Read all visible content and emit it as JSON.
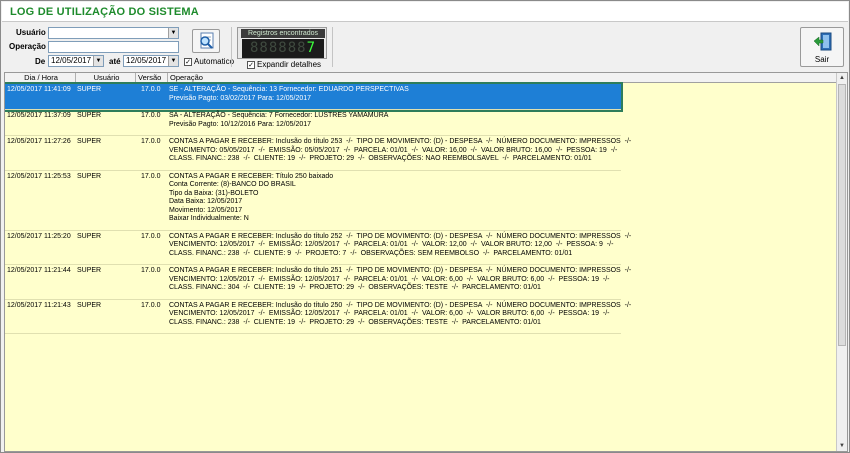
{
  "window": {
    "title": "LOG DE UTILIZAÇÃO DO SISTEMA"
  },
  "filters": {
    "usuario_label": "Usuário",
    "usuario_value": "",
    "operacao_label": "Operação",
    "operacao_value": "",
    "de_label": "De",
    "de_value": "12/05/2017",
    "ate_label": "até",
    "ate_value": "12/05/2017",
    "automatico_label": "Automatico",
    "automatico_checked": true,
    "expandir_label": "Expandir detalhes",
    "expandir_checked": true
  },
  "counter": {
    "caption": "Registros encontrados",
    "digits_dim": "888888",
    "digits_lit": "7"
  },
  "toolbar": {
    "search_icon": "magnifier-document-icon",
    "exit_label": "Sair",
    "exit_icon": "door-exit-icon"
  },
  "grid": {
    "headers": [
      "Dia / Hora",
      "Usuário",
      "Versão",
      "Operação"
    ],
    "rows": [
      {
        "datetime": "12/05/2017 11:41:09",
        "user": "SUPER",
        "version": "17.0.0",
        "operation": "SE - ALTERAÇÃO - Sequência: 13 Fornecedor: EDUARDO PERSPECTIVAS\nPrevisão Pagto: 03/02/2017 Para: 12/05/2017",
        "selected": true
      },
      {
        "datetime": "12/05/2017 11:37:09",
        "user": "SUPER",
        "version": "17.0.0",
        "operation": "SA - ALTERAÇÃO - Sequência: 7 Fornecedor: LUSTRES YAMAMURA\nPrevisão Pagto: 10/12/2016 Para: 12/05/2017",
        "selected": false
      },
      {
        "datetime": "12/05/2017 11:27:26",
        "user": "SUPER",
        "version": "17.0.0",
        "operation": "CONTAS A PAGAR E RECEBER: Inclusão do título 253  -/-  TIPO DE MOVIMENTO: (D) - DESPESA  -/-  NÚMERO DOCUMENTO: IMPRESSOS  -/-\nVENCIMENTO: 05/05/2017  -/-  EMISSÃO: 05/05/2017  -/-  PARCELA: 01/01  -/-  VALOR: 16,00  -/-  VALOR BRUTO: 16,00  -/-  PESSOA: 19  -/-\nCLASS. FINANC.: 238  -/-  CLIENTE: 19  -/-  PROJETO: 29  -/-  OBSERVAÇÕES: NAO REEMBOLSAVEL  -/-  PARCELAMENTO: 01/01",
        "selected": false
      },
      {
        "datetime": "12/05/2017 11:25:53",
        "user": "SUPER",
        "version": "17.0.0",
        "operation": "CONTAS A PAGAR E RECEBER: Título 250 baixado\nConta Corrente: (8)-BANCO DO BRASIL\nTipo da Baixa: (31)-BOLETO\nData Baixa: 12/05/2017\nMovimento: 12/05/2017\nBaixar Individualmente: N",
        "selected": false
      },
      {
        "datetime": "12/05/2017 11:25:20",
        "user": "SUPER",
        "version": "17.0.0",
        "operation": "CONTAS A PAGAR E RECEBER: Inclusão do título 252  -/-  TIPO DE MOVIMENTO: (D) - DESPESA  -/-  NÚMERO DOCUMENTO: IMPRESSOS  -/-\nVENCIMENTO: 12/05/2017  -/-  EMISSÃO: 12/05/2017  -/-  PARCELA: 01/01  -/-  VALOR: 12,00  -/-  VALOR BRUTO: 12,00  -/-  PESSOA: 9  -/-\nCLASS. FINANC.: 238  -/-  CLIENTE: 9  -/-  PROJETO: 7  -/-  OBSERVAÇÕES: SEM REEMBOLSO  -/-  PARCELAMENTO: 01/01",
        "selected": false
      },
      {
        "datetime": "12/05/2017 11:21:44",
        "user": "SUPER",
        "version": "17.0.0",
        "operation": "CONTAS A PAGAR E RECEBER: Inclusão do título 251  -/-  TIPO DE MOVIMENTO: (D) - DESPESA  -/-  NÚMERO DOCUMENTO: IMPRESSOS  -/-\nVENCIMENTO: 12/05/2017  -/-  EMISSÃO: 12/05/2017  -/-  PARCELA: 01/01  -/-  VALOR: 6,00  -/-  VALOR BRUTO: 6,00  -/-  PESSOA: 19  -/-\nCLASS. FINANC.: 304  -/-  CLIENTE: 19  -/-  PROJETO: 29  -/-  OBSERVAÇÕES: TESTE  -/-  PARCELAMENTO: 01/01",
        "selected": false
      },
      {
        "datetime": "12/05/2017 11:21:43",
        "user": "SUPER",
        "version": "17.0.0",
        "operation": "CONTAS A PAGAR E RECEBER: Inclusão do título 250  -/-  TIPO DE MOVIMENTO: (D) - DESPESA  -/-  NÚMERO DOCUMENTO: IMPRESSOS  -/-\nVENCIMENTO: 12/05/2017  -/-  EMISSÃO: 12/05/2017  -/-  PARCELA: 01/01  -/-  VALOR: 6,00  -/-  VALOR BRUTO: 6,00  -/-  PESSOA: 19  -/-\nCLASS. FINANC.: 238  -/-  CLIENTE: 19  -/-  PROJETO: 29  -/-  OBSERVAÇÕES: TESTE  -/-  PARCELAMENTO: 01/01",
        "selected": false
      }
    ]
  },
  "colors": {
    "title_green": "#1e8b2c",
    "grid_bg": "#ffffcc",
    "selection": "#1e7fd6"
  }
}
